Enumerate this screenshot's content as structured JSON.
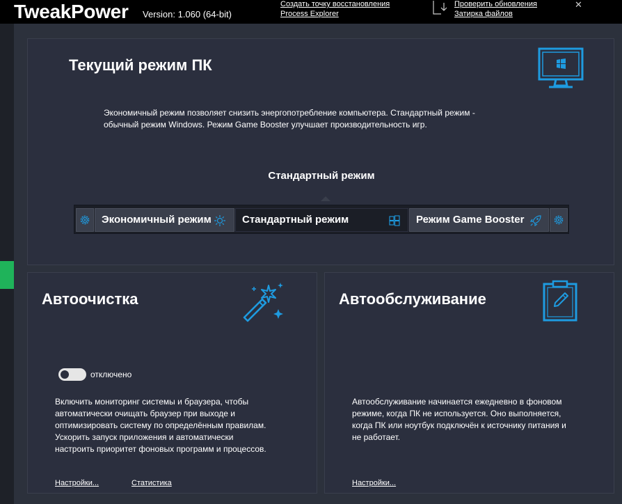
{
  "header": {
    "app_name": "TweakPower",
    "version": "Version: 1.060 (64-bit)",
    "links": {
      "restore_point": "Создать точку восстановления",
      "process_explorer": "Process Explorer",
      "check_updates": "Проверить обновления",
      "file_shredder": "Затирка файлов"
    },
    "close_glyph": "✕"
  },
  "pc_mode": {
    "title": "Текущий режим ПК",
    "description_line1": "Экономичный режим позволяет снизить энергопотребление компьютера. Стандартный режим -",
    "description_line2": "обычный режим Windows. Режим Game Booster улучшает производительность игр.",
    "current_mode": "Стандартный режим",
    "modes": {
      "eco": "Экономичный режим",
      "standard": "Стандартный режим",
      "game": "Режим Game Booster"
    },
    "icons": {
      "panel": "monitor-windows-icon",
      "eco": "sun-icon",
      "standard": "windows-logo-icon",
      "game": "rocket-icon",
      "settings": "gear-icon"
    }
  },
  "auto_clean": {
    "title": "Автоочистка",
    "toggle_label": "отключено",
    "toggle_on": false,
    "description": [
      "Включить мониторинг системы и браузера, чтобы",
      "автоматически очищать браузер при выходе и",
      "оптимизировать систему по определённым правилам.",
      "Ускорить запуск приложения и автоматически",
      "настроить приоритет фоновых программ и процессов."
    ],
    "settings_link": "Настройки...",
    "stats_link": "Статистика",
    "icon": "magic-wand-icon"
  },
  "auto_maintenance": {
    "title": "Автообслуживание",
    "description": [
      "Автообслуживание начинается ежедневно в фоновом",
      "режиме, когда ПК не используется. Оно выполняется,",
      "когда ПК или ноутбук подключён к источнику питания и",
      "не работает."
    ],
    "settings_link": "Настройки...",
    "icon": "clipboard-pen-icon"
  },
  "colors": {
    "accent": "#1e9be0",
    "active_indicator": "#1fb35a",
    "panel_bg": "#2b2f3e",
    "header_bg": "#000000"
  }
}
